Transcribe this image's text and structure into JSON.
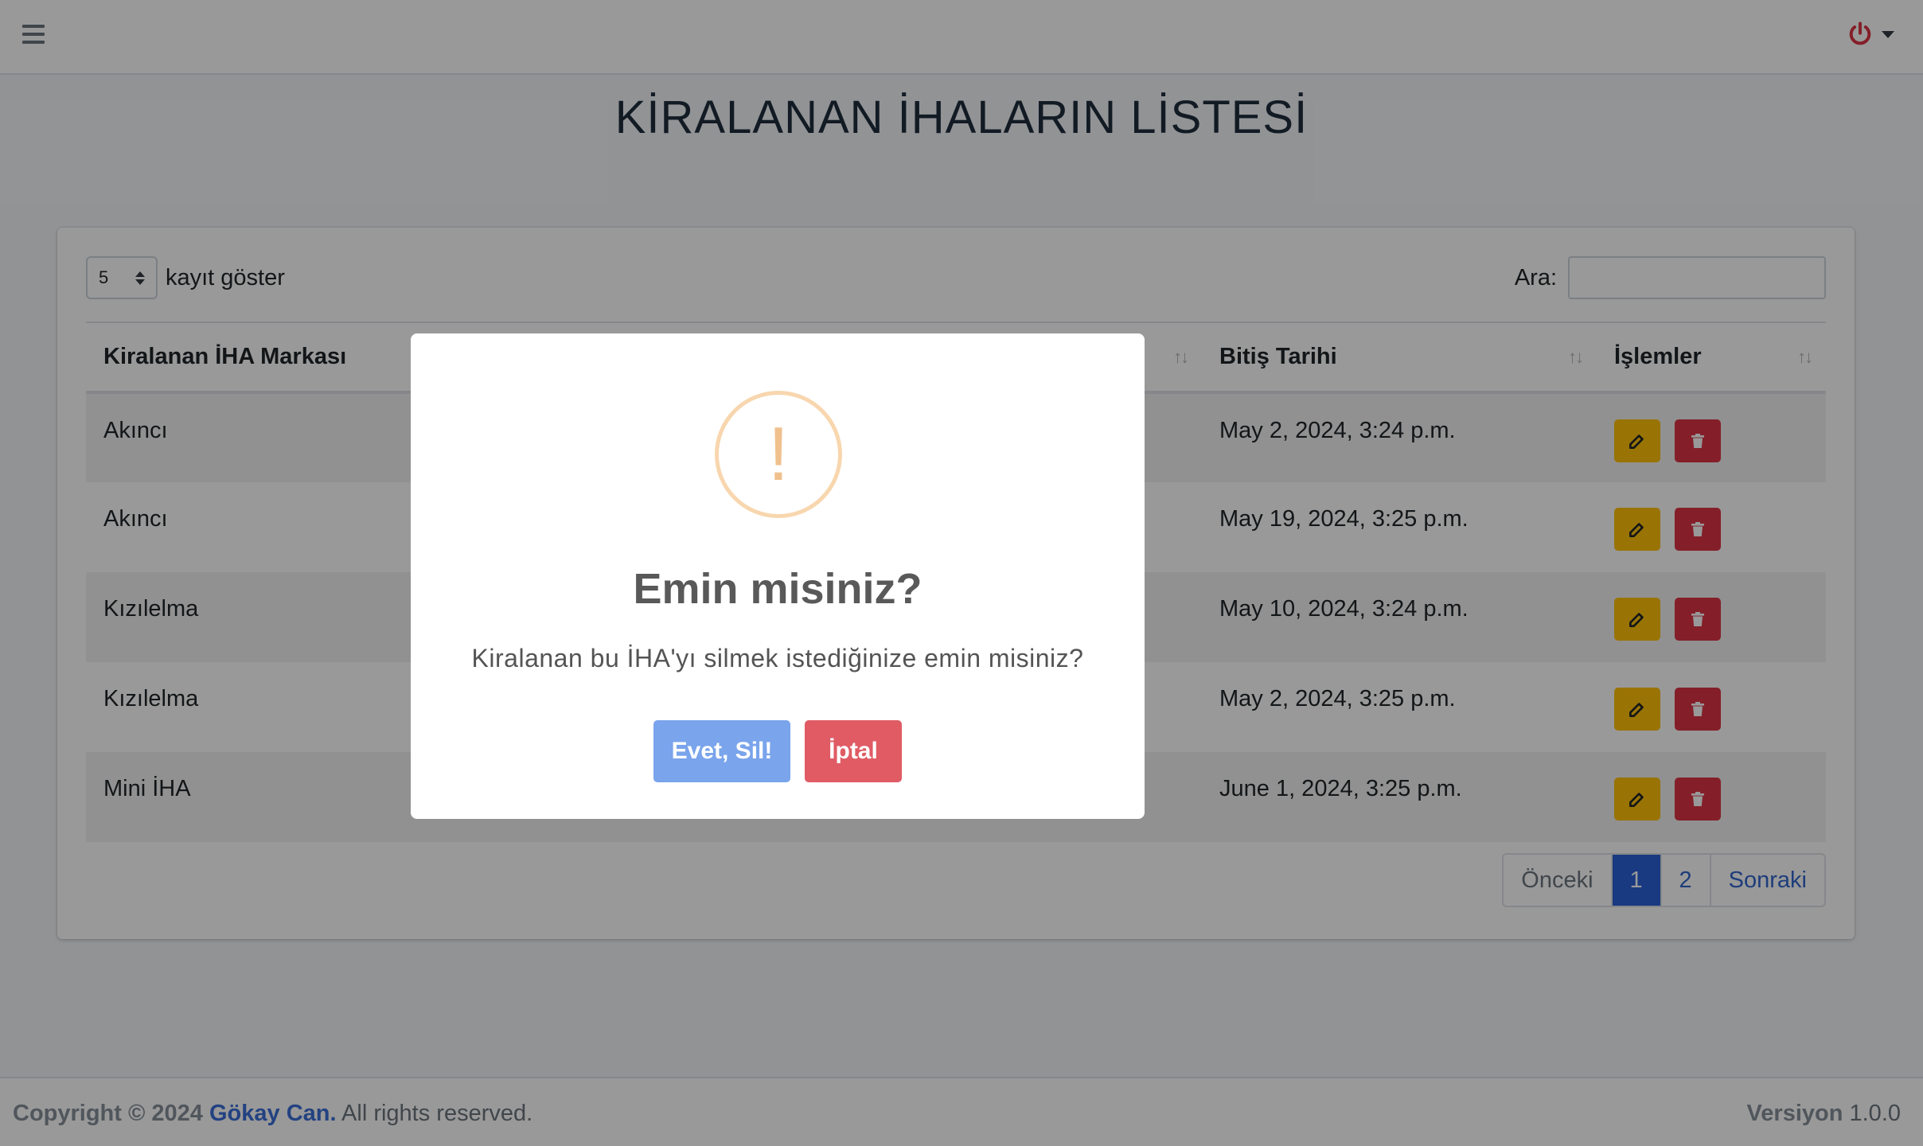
{
  "header": {
    "menu_icon": "hamburger-icon",
    "user_icon": "power-icon",
    "power_color": "#dc3545"
  },
  "page": {
    "title": "KİRALANAN İHALARIN LİSTESİ"
  },
  "table_controls": {
    "length_value": "5",
    "length_suffix": "kayıt göster",
    "search_label": "Ara:",
    "search_value": ""
  },
  "table": {
    "columns": [
      "Kiralanan İHA Markası",
      "Bitiş Tarihi",
      "İşlemler"
    ],
    "rows": [
      {
        "brand": "Akıncı",
        "end_date": "May 2, 2024, 3:24 p.m."
      },
      {
        "brand": "Akıncı",
        "end_date": "May 19, 2024, 3:25 p.m."
      },
      {
        "brand": "Kızılelma",
        "end_date": "May 10, 2024, 3:24 p.m."
      },
      {
        "brand": "Kızılelma",
        "end_date": "May 2, 2024, 3:25 p.m."
      },
      {
        "brand": "Mini İHA",
        "end_date": "June 1, 2024, 3:25 p.m."
      }
    ],
    "edit_icon": "edit-icon",
    "delete_icon": "trash-icon"
  },
  "pagination": {
    "prev": "Önceki",
    "pages": [
      "1",
      "2"
    ],
    "active": "1",
    "next": "Sonraki"
  },
  "footer": {
    "copyright": "Copyright © 2024",
    "author": "Gökay Can.",
    "rights": "All rights reserved.",
    "version_label": "Versiyon",
    "version": "1.0.0"
  },
  "modal": {
    "icon": "warning-icon",
    "icon_glyph": "!",
    "title": "Emin misiniz?",
    "text": "Kiralanan bu İHA'yı silmek istediğinize emin misiniz?",
    "confirm": "Evet, Sil!",
    "cancel": "İptal"
  }
}
